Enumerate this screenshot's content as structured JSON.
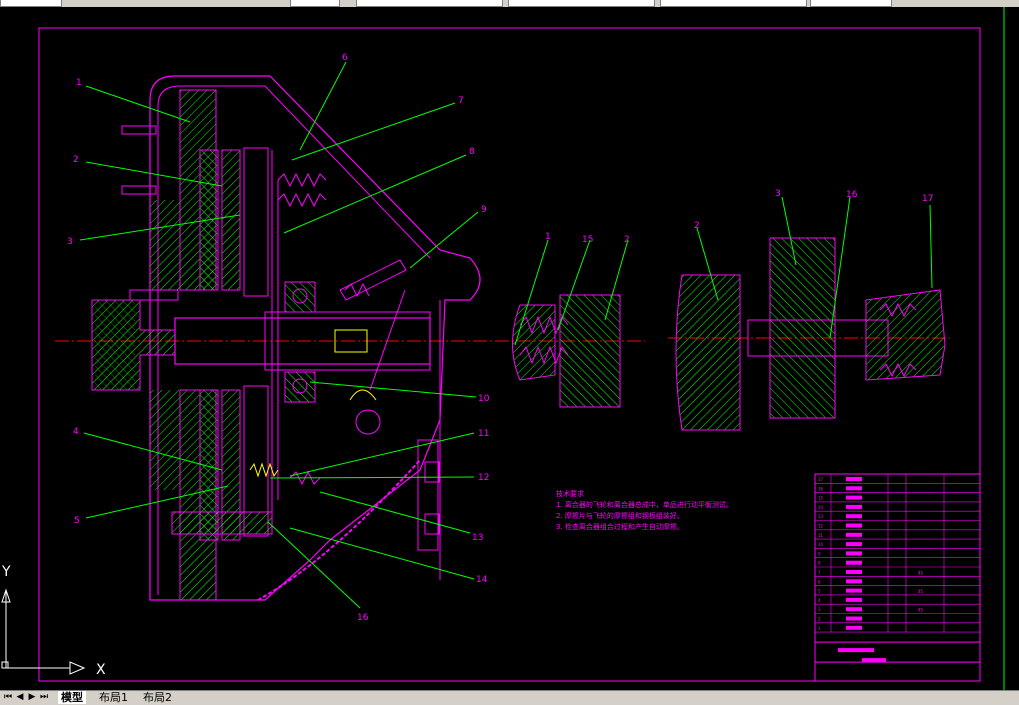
{
  "tabs": {
    "active": "模型",
    "layout1": "布局1",
    "layout2": "布局2"
  },
  "nav": {
    "first": "⏮",
    "prev": "◀",
    "next": "▶",
    "last": "⏭"
  },
  "ucs": {
    "x_label": "X",
    "y_label": "Y"
  },
  "colors": {
    "frame": "#ff00ff",
    "leader": "#00ff00",
    "centerline": "#ff0000",
    "hatch": "#00ff00",
    "label": "#ff00ff",
    "bolt": "#ffff00"
  },
  "main_view": {
    "part_labels": [
      "1",
      "2",
      "3",
      "4",
      "5",
      "6",
      "7",
      "8",
      "9",
      "10",
      "11",
      "12",
      "13",
      "14",
      "16"
    ]
  },
  "detail_a": {
    "part_labels": [
      "1",
      "15",
      "2"
    ]
  },
  "detail_b": {
    "part_labels": [
      "2",
      "3",
      "16",
      "17"
    ]
  },
  "notes": {
    "title": "技术要求",
    "lines": [
      "1. 离合器的飞轮和离合器总成中，单品进行动平衡测试。",
      "2. 摩擦片与飞轮的摩擦组和钢板组装好。",
      "3. 检查离合器组合过程和产生自动摩擦。"
    ]
  },
  "title_block": {
    "rows": [
      "17",
      "16",
      "15",
      "14",
      "13",
      "12",
      "11",
      "10",
      "9",
      "8",
      "7",
      "6",
      "5",
      "4",
      "3",
      "2",
      "1"
    ],
    "cell_values": [
      "45",
      "45",
      "45"
    ]
  }
}
